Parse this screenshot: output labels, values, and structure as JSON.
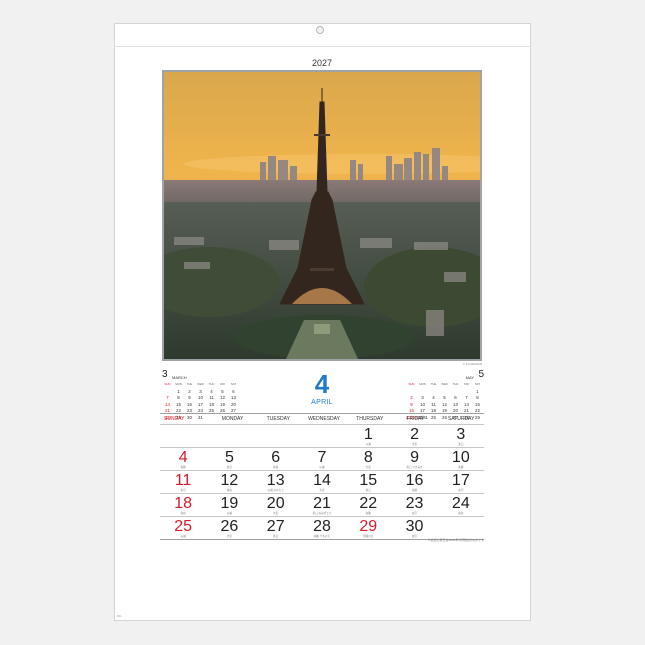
{
  "calendar": {
    "year": "2027",
    "photo_credit": "© F.KARAVAN",
    "month_number": "4",
    "month_name": "APRIL",
    "weekdays": [
      "SUNDAY",
      "MONDAY",
      "TUESDAY",
      "WEDNESDAY",
      "THURSDAY",
      "FRIDAY",
      "SATURDAY"
    ],
    "weeks": [
      [
        {
          "d": ""
        },
        {
          "d": ""
        },
        {
          "d": ""
        },
        {
          "d": ""
        },
        {
          "d": "1",
          "n": "仏滅"
        },
        {
          "d": "2",
          "n": "大安"
        },
        {
          "d": "3",
          "n": "赤口"
        }
      ],
      [
        {
          "d": "4",
          "n": "先勝"
        },
        {
          "d": "5",
          "n": "友引"
        },
        {
          "d": "6",
          "n": "先負"
        },
        {
          "d": "7",
          "n": "仏滅"
        },
        {
          "d": "8",
          "n": "大安"
        },
        {
          "d": "9",
          "n": "赤口 つきみき"
        },
        {
          "d": "10",
          "n": "先勝"
        }
      ],
      [
        {
          "d": "11",
          "n": "友引"
        },
        {
          "d": "12",
          "n": "先負"
        },
        {
          "d": "13",
          "n": "仏滅 かのえと"
        },
        {
          "d": "14",
          "n": "大安"
        },
        {
          "d": "15",
          "n": "赤口"
        },
        {
          "d": "16",
          "n": "先勝"
        },
        {
          "d": "17",
          "n": "友引"
        }
      ],
      [
        {
          "d": "18",
          "n": "先負"
        },
        {
          "d": "19",
          "n": "仏滅"
        },
        {
          "d": "20",
          "n": "大安"
        },
        {
          "d": "21",
          "n": "赤口 おみずとり"
        },
        {
          "d": "22",
          "n": "先勝"
        },
        {
          "d": "23",
          "n": "友引"
        },
        {
          "d": "24",
          "n": "先負"
        }
      ],
      [
        {
          "d": "25",
          "n": "仏滅"
        },
        {
          "d": "26",
          "n": "大安"
        },
        {
          "d": "27",
          "n": "赤口"
        },
        {
          "d": "28",
          "n": "先勝 つちのえ"
        },
        {
          "d": "29",
          "n": "昭和の日",
          "hol": true
        },
        {
          "d": "30",
          "n": "友引"
        },
        {
          "d": ""
        }
      ]
    ],
    "footnote": "※表記の祝日は2026年1月現在のものです"
  },
  "prev_month": {
    "number": "3",
    "name": "MARCH",
    "weekdays": [
      "SUN",
      "MON",
      "TUE",
      "WED",
      "THU",
      "FRI",
      "SAT"
    ],
    "days": [
      "",
      "1",
      "2",
      "3",
      "4",
      "5",
      "6",
      "7",
      "8",
      "9",
      "10",
      "11",
      "12",
      "13",
      "14",
      "15",
      "16",
      "17",
      "18",
      "19",
      "20",
      "21",
      "22",
      "23",
      "24",
      "25",
      "26",
      "27",
      "28",
      "29",
      "30",
      "31",
      "",
      "",
      ""
    ]
  },
  "next_month": {
    "number": "5",
    "name": "MAY",
    "weekdays": [
      "SUN",
      "MON",
      "TUE",
      "WED",
      "THU",
      "FRI",
      "SAT"
    ],
    "days": [
      "",
      "",
      "",
      "",
      "",
      "",
      "1",
      "2",
      "3",
      "4",
      "5",
      "6",
      "7",
      "8",
      "9",
      "10",
      "11",
      "12",
      "13",
      "14",
      "15",
      "16",
      "17",
      "18",
      "19",
      "20",
      "21",
      "22",
      "23/30",
      "24/31",
      "25",
      "26",
      "27",
      "28",
      "29"
    ]
  },
  "product_code": "NK-",
  "colors": {
    "accent": "#1f7ac9",
    "sunday": "#d8192a",
    "text": "#222222"
  }
}
